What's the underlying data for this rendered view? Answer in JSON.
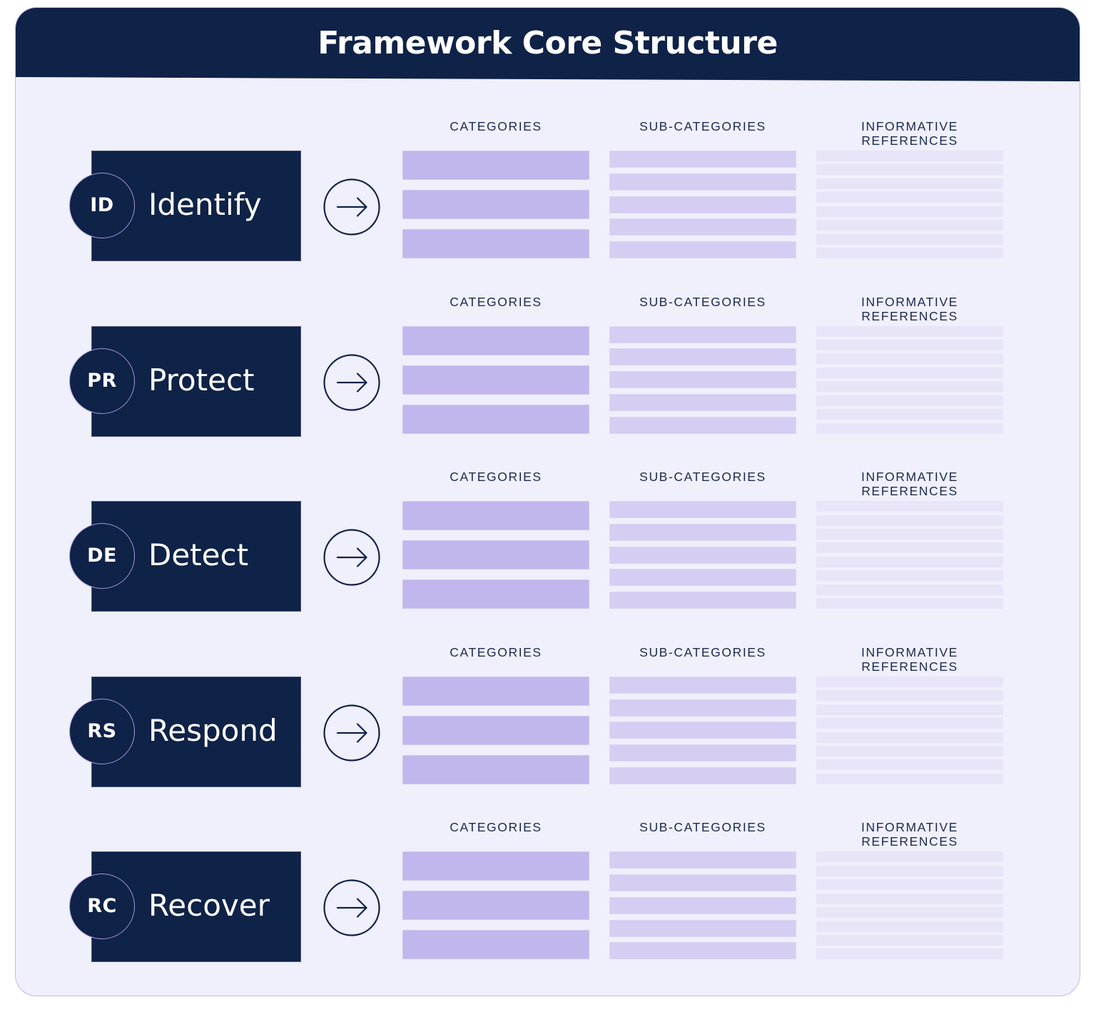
{
  "title": "Framework Core Structure",
  "colors": {
    "navy": "#0f2247",
    "background": "#f0effc",
    "border": "#c3b8ec",
    "categories_bar": "#c2b7ec",
    "subcategories_bar": "#d5cdf2",
    "references_bar": "#e8e5f9"
  },
  "column_labels": {
    "categories": "CATEGORIES",
    "subcategories": "SUB-CATEGORIES",
    "references": "INFORMATIVE REFERENCES"
  },
  "functions": [
    {
      "code": "ID",
      "name": "Identify",
      "categories_count": 3,
      "subcategories_count": 5,
      "references_count": 8,
      "icon": "arrow-right-circle-icon"
    },
    {
      "code": "PR",
      "name": "Protect",
      "categories_count": 3,
      "subcategories_count": 5,
      "references_count": 8,
      "icon": "arrow-right-circle-icon"
    },
    {
      "code": "DE",
      "name": "Detect",
      "categories_count": 3,
      "subcategories_count": 5,
      "references_count": 8,
      "icon": "arrow-right-circle-icon"
    },
    {
      "code": "RS",
      "name": "Respond",
      "categories_count": 3,
      "subcategories_count": 5,
      "references_count": 8,
      "icon": "arrow-right-circle-icon"
    },
    {
      "code": "RC",
      "name": "Recover",
      "categories_count": 3,
      "subcategories_count": 5,
      "references_count": 8,
      "icon": "arrow-right-circle-icon"
    }
  ]
}
